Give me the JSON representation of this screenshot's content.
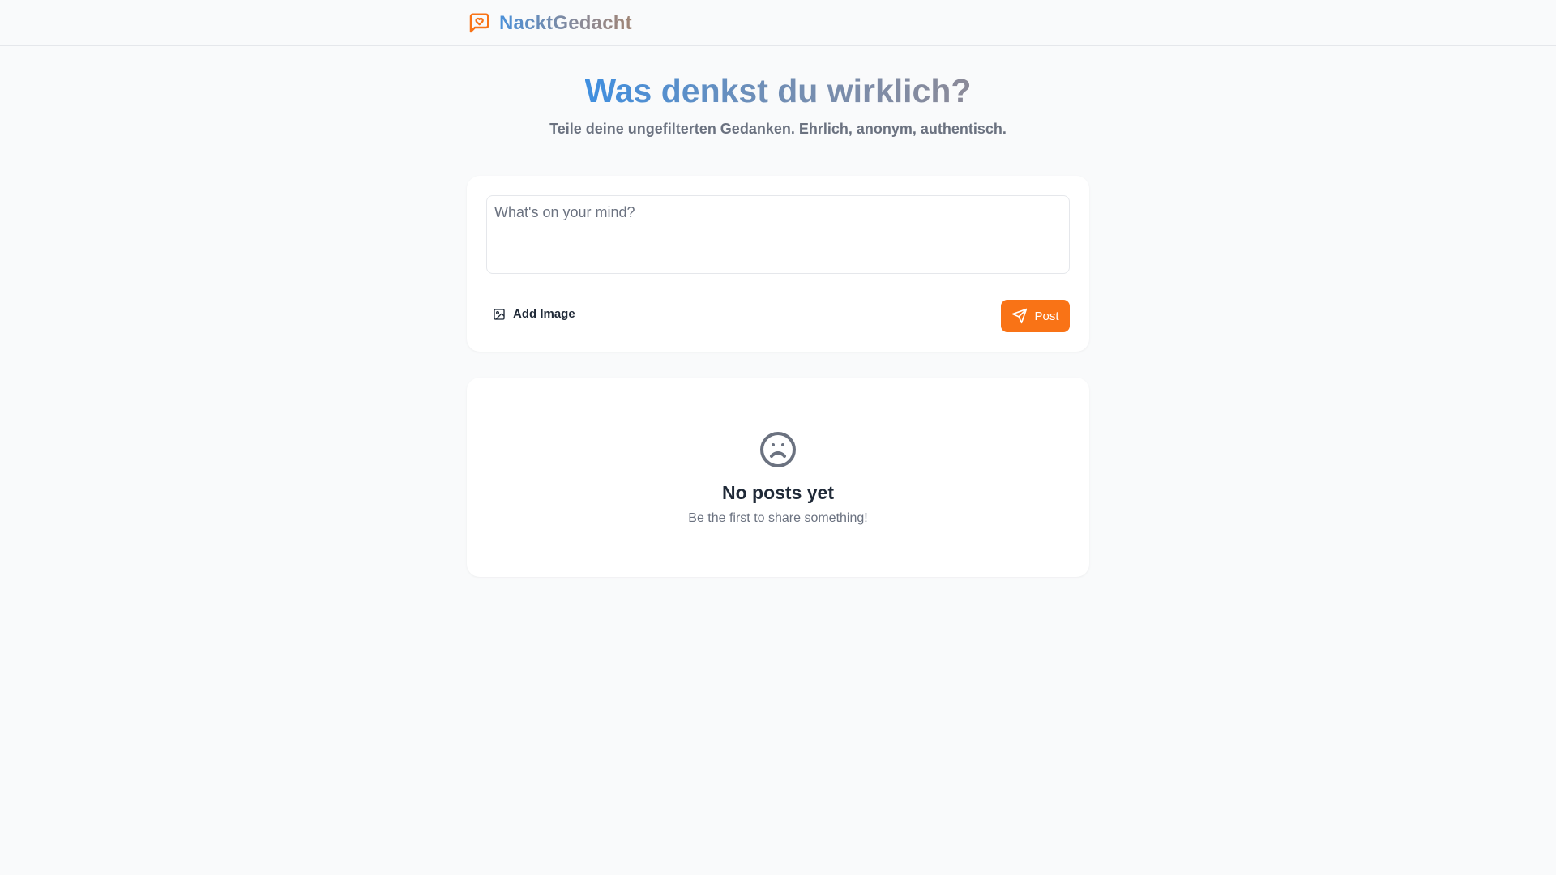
{
  "header": {
    "brand_name": "NacktGedacht",
    "logo_icon": "message-heart-icon",
    "accent_color": "#f97316"
  },
  "hero": {
    "title": "Was denkst du wirklich?",
    "subtitle": "Teile deine ungefilterten Gedanken. Ehrlich, anonym, authentisch."
  },
  "composer": {
    "input_value": "",
    "input_placeholder": "What's on your mind?",
    "add_image_label": "Add Image",
    "add_image_icon": "image-icon",
    "post_label": "Post",
    "post_icon": "send-icon",
    "post_color": "#f97316"
  },
  "feed": {
    "empty_icon": "sad-face-icon",
    "empty_title": "No posts yet",
    "empty_subtitle": "Be the first to share something!"
  }
}
